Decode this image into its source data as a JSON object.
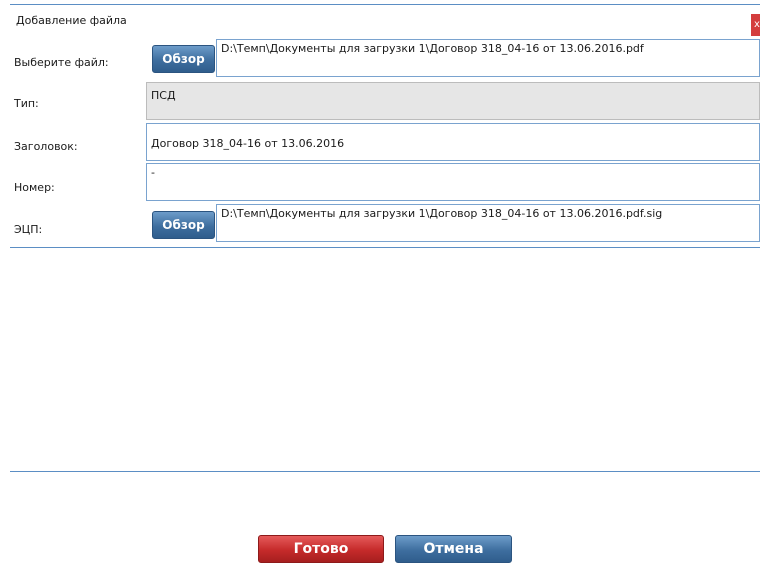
{
  "dialog": {
    "title": "Добавление файла",
    "close_label": "x"
  },
  "form": {
    "file_label": "Выберите файл:",
    "file_browse_label": "Обзор",
    "file_path": "D:\\Темп\\Документы для загрузки 1\\Договор 318_04-16 от 13.06.2016.pdf",
    "type_label": "Тип:",
    "type_value": "ПСД",
    "heading_label": "Заголовок:",
    "heading_value": "Договор 318_04-16 от 13.06.2016",
    "number_label": "Номер:",
    "number_value": "-",
    "signature_label": "ЭЦП:",
    "signature_browse_label": "Обзор",
    "signature_path": "D:\\Темп\\Документы для загрузки 1\\Договор 318_04-16 от 13.06.2016.pdf.sig"
  },
  "footer": {
    "done_label": "Готово",
    "cancel_label": "Отмена"
  },
  "colors": {
    "accent_blue": "#3e6e9f",
    "done_red": "#c52a2a",
    "border_blue": "#7aa3cf"
  }
}
